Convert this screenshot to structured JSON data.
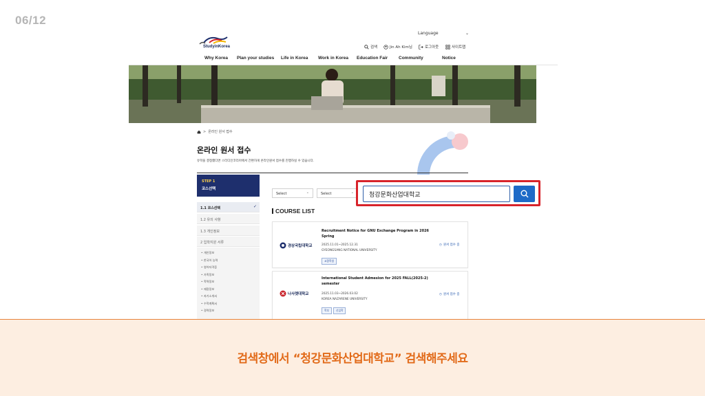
{
  "slide": {
    "page_number": "06/12"
  },
  "header": {
    "language_label": "Language",
    "logo_text": "StudyinKorea",
    "util": {
      "search": "검색",
      "user": "Jin Ah Kim님",
      "logout": "로그아웃",
      "sitemap": "사이트맵"
    },
    "nav": [
      "Why Korea",
      "Plan your studies",
      "Life in Korea",
      "Work in Korea",
      "Education Fair",
      "Community",
      "Notice"
    ]
  },
  "breadcrumb": {
    "current": "온라인 원서 접수"
  },
  "page": {
    "title": "온라인 원서 접수",
    "description": "유학을 결정했다면 스터디인코리아에서 간편하게 온라인원서 접수를 진행하실 수 있습니다."
  },
  "steps": {
    "step_label": "STEP 1",
    "step_title": "코스선택",
    "items": [
      "1.1 코스선택",
      "1.2 유의 사항",
      "1.3 개인정보",
      "2 입학지원 서류"
    ],
    "sub_items": [
      "개인정보",
      "한국어 능력",
      "영어자격증",
      "가족정보",
      "학력정보",
      "재정정보",
      "자기소개서",
      "수학계획서",
      "경력정보"
    ]
  },
  "filters": {
    "select1": "Select",
    "select2": "Select"
  },
  "search": {
    "value": "청강문화산업대학교"
  },
  "course_list": {
    "heading": "COURSE LIST",
    "cards": [
      {
        "logo_name": "경상국립대학교",
        "title": "Recruitment Notice for GNU Exchange Program in 2026 Spring",
        "date": "2025.11.01~2025.12.31",
        "university": "GYEONGSANG NATIONAL UNIVERSITY",
        "tags": [
          "교환학생"
        ],
        "status": "원서 접수 중"
      },
      {
        "logo_name": "나사렛대학교",
        "title": "International Student Admesion for 2025 FALL(2025-2) semester",
        "date": "2025.11.03~2026.03.02",
        "university": "KOREA NAZARENE UNIVERSITY",
        "tags": [
          "학부",
          "신입학"
        ],
        "status": "원서 접수 중"
      }
    ]
  },
  "caption": "검색창에서 “청강문화산업대학교” 검색해주세요",
  "colors": {
    "navy": "#1e2f6d",
    "search_blue": "#1e6ac7",
    "highlight_red": "#d8232a",
    "caption_orange": "#e26b1a",
    "caption_bg": "#fdeee1"
  }
}
